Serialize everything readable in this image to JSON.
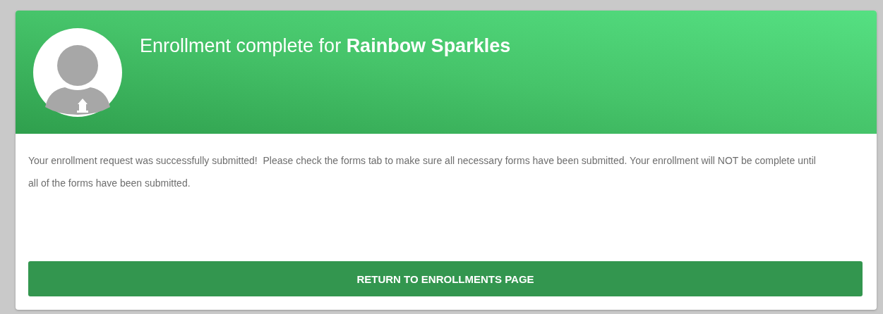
{
  "header": {
    "title": "Enrollment complete for **Rainbow Sparkles**"
  },
  "message": "Your enrollment request was successfully submitted!  Please check the forms tab to make sure all necessary forms have been submitted. Your enrollment will NOT be complete until all of the forms have been submitted.",
  "button": {
    "label": "RETURN TO ENROLLMENTS PAGE"
  }
}
